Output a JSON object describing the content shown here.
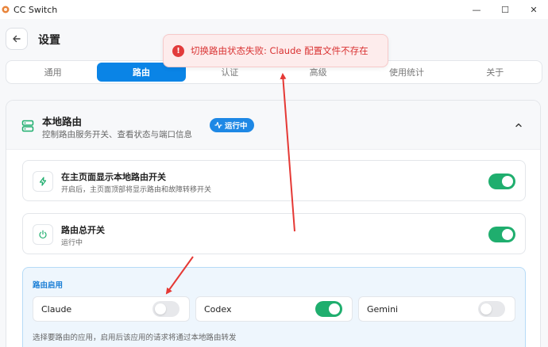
{
  "window": {
    "title": "CC Switch",
    "controls": [
      "—",
      "☐",
      "✕"
    ]
  },
  "header": {
    "title": "设置"
  },
  "toast": {
    "message": "切换路由状态失败: Claude 配置文件不存在",
    "icon": "error-icon",
    "color": "#d93232"
  },
  "tabs": [
    {
      "label": "通用",
      "active": false
    },
    {
      "label": "路由",
      "active": true
    },
    {
      "label": "认证",
      "active": false
    },
    {
      "label": "高级",
      "active": false
    },
    {
      "label": "使用统计",
      "active": false
    },
    {
      "label": "关于",
      "active": false
    }
  ],
  "section": {
    "title": "本地路由",
    "description": "控制路由服务开关、查看状态与端口信息",
    "status": "运行中",
    "status_color": "#1e88e5"
  },
  "settings": [
    {
      "title": "在主页面显示本地路由开关",
      "description": "开启后，主页面顶部将显示路由和故障转移开关",
      "icon": "lightning-icon",
      "enabled": true
    },
    {
      "title": "路由总开关",
      "description": "运行中",
      "icon": "power-icon",
      "enabled": true
    }
  ],
  "apps": {
    "label": "路由启用",
    "items": [
      {
        "name": "Claude",
        "enabled": false
      },
      {
        "name": "Codex",
        "enabled": true
      },
      {
        "name": "Gemini",
        "enabled": false
      }
    ],
    "hint": "选择要路由的应用，启用后该应用的请求将通过本地路由转发"
  },
  "colors": {
    "accent": "#0a84e6",
    "toggle_on": "#1fae6e",
    "annotation": "#e53935"
  }
}
